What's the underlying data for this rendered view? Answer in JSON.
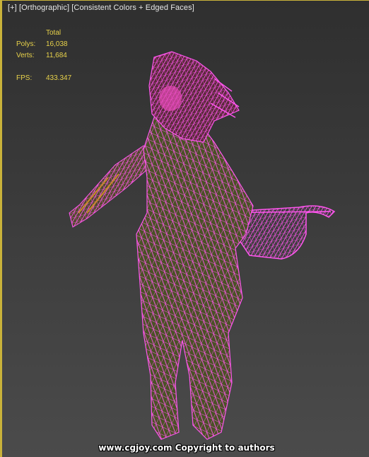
{
  "viewport": {
    "label": {
      "plus": "[+]",
      "view": "[Orthographic]",
      "shading": "[Consistent Colors + Edged Faces]"
    },
    "stats": {
      "header": "Total",
      "polys_label": "Polys:",
      "polys_value": "16,038",
      "verts_label": "Verts:",
      "verts_value": "11,684",
      "fps_label": "FPS:",
      "fps_value": "433.347"
    },
    "wireframe_color": "#ff55ee",
    "watermark": "www.cgjoy.com Copyright to authors"
  }
}
